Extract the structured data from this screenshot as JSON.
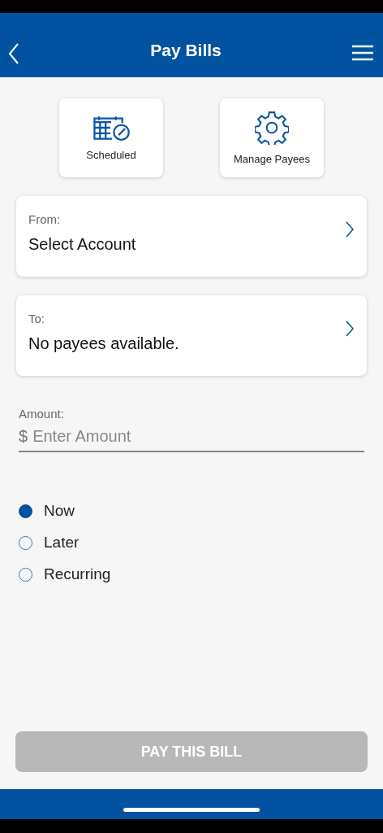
{
  "header": {
    "title": "Pay Bills"
  },
  "shortcuts": [
    {
      "kind": "calendar",
      "label": "Scheduled"
    },
    {
      "kind": "gear",
      "label": "Manage Payees"
    }
  ],
  "selectors": [
    {
      "label": "From:",
      "value": "Select Account"
    },
    {
      "label": "To:",
      "value": "No payees available."
    }
  ],
  "amount": {
    "label": "Amount:",
    "currency": "$",
    "placeholder": "Enter Amount"
  },
  "timing": [
    {
      "label": "Now",
      "selected": true
    },
    {
      "label": "Later",
      "selected": false
    },
    {
      "label": "Recurring",
      "selected": false
    }
  ],
  "submit": {
    "label": "PAY THIS BILL",
    "disabled": true
  }
}
